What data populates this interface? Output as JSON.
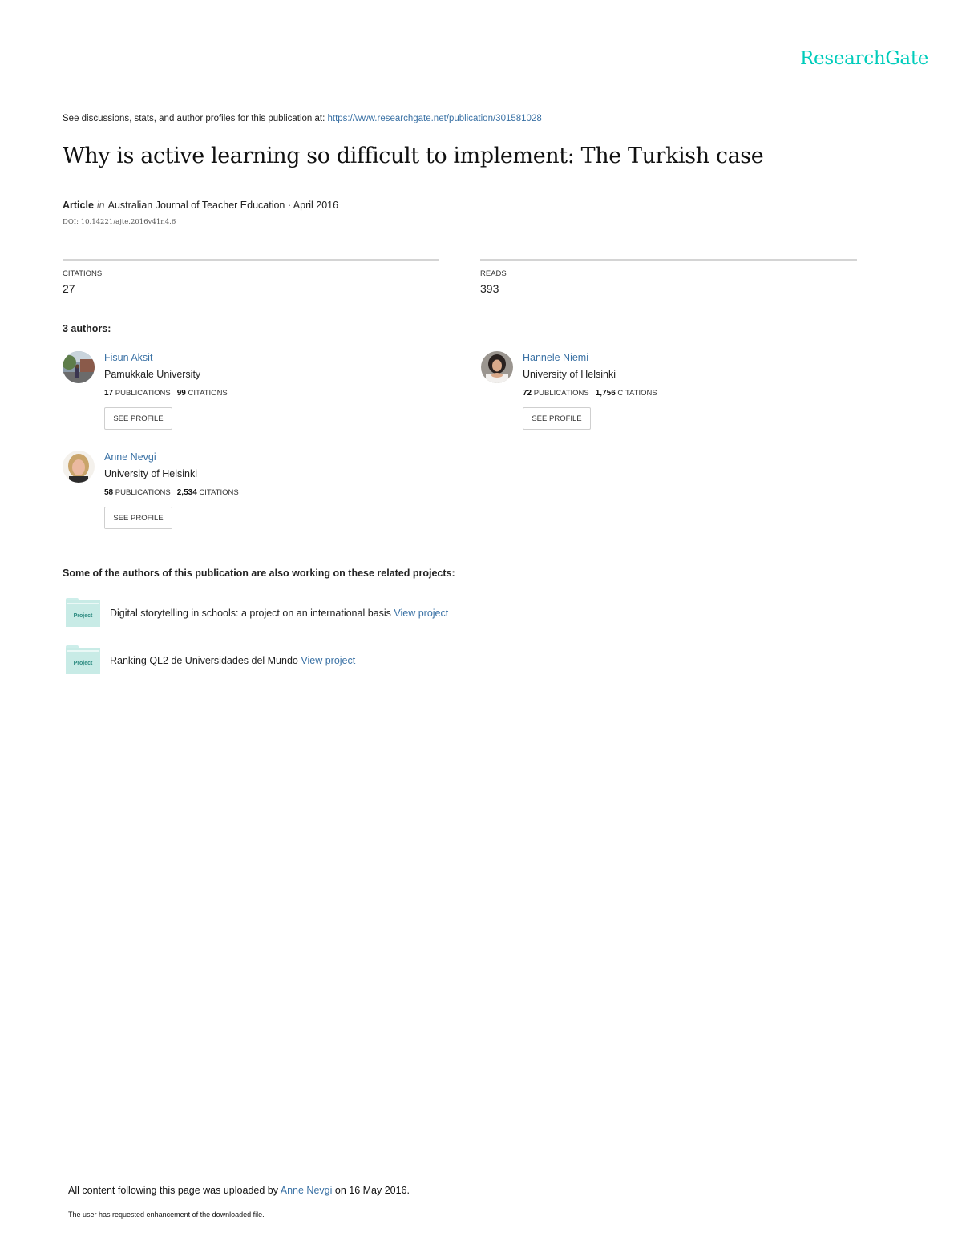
{
  "brand": {
    "logo_text": "ResearchGate",
    "accent_color": "#00ccbb",
    "link_color": "#3b72a5"
  },
  "header": {
    "intro_text": "See discussions, stats, and author profiles for this publication at: ",
    "publication_url": "https://www.researchgate.net/publication/301581028"
  },
  "publication": {
    "title": "Why is active learning so difficult to implement: The Turkish case",
    "type": "Article",
    "in_label": "in",
    "journal_date": "Australian Journal of Teacher Education · April 2016",
    "doi": "DOI: 10.14221/ajte.2016v41n4.6"
  },
  "stats": {
    "citations_label": "CITATIONS",
    "citations_value": "27",
    "reads_label": "READS",
    "reads_value": "393"
  },
  "authors_heading": "3 authors:",
  "authors": [
    {
      "name": "Fisun Aksit",
      "institution": "Pamukkale University",
      "publications": "17",
      "publications_label": "PUBLICATIONS",
      "citations": "99",
      "citations_label": "CITATIONS",
      "button_label": "SEE PROFILE"
    },
    {
      "name": "Hannele Niemi",
      "institution": "University of Helsinki",
      "publications": "72",
      "publications_label": "PUBLICATIONS",
      "citations": "1,756",
      "citations_label": "CITATIONS",
      "button_label": "SEE PROFILE"
    },
    {
      "name": "Anne Nevgi",
      "institution": "University of Helsinki",
      "publications": "58",
      "publications_label": "PUBLICATIONS",
      "citations": "2,534",
      "citations_label": "CITATIONS",
      "button_label": "SEE PROFILE"
    }
  ],
  "projects_heading": "Some of the authors of this publication are also working on these related projects:",
  "projects": [
    {
      "icon_label": "Project",
      "title": "Digital storytelling in schools: a project on an international basis",
      "link_label": "View project"
    },
    {
      "icon_label": "Project",
      "title": "Ranking QL2 de Universidades del Mundo",
      "link_label": "View project"
    }
  ],
  "footer": {
    "uploaded_prefix": "All content following this page was uploaded by ",
    "uploader": "Anne Nevgi",
    "uploaded_suffix": " on 16 May 2016.",
    "enhancement_note": "The user has requested enhancement of the downloaded file."
  }
}
